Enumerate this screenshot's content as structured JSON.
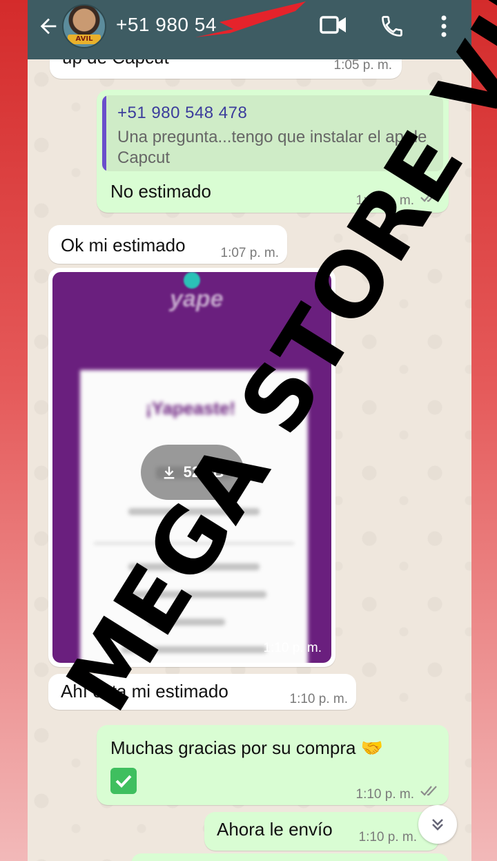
{
  "header": {
    "contact_name": "+51 980 54",
    "avatar_tag": "AVIL"
  },
  "messages": [
    {
      "text": "up de Capcut",
      "time": "1:05 p. m."
    },
    {
      "quote": {
        "name": "+51 980 548 478",
        "text": "Una pregunta...tengo que instalar el ap de Capcut"
      },
      "text": "No estimado",
      "time": "1:07 p. m."
    },
    {
      "text": "Ok mi estimado",
      "time": "1:07 p. m."
    },
    {
      "image_size": "52 kB",
      "image_title": "¡Yapeaste!",
      "time": "1:10 p. m."
    },
    {
      "text": "Ahí esta mi estimado",
      "time": "1:10 p. m."
    },
    {
      "text": "Muchas gracias por su compra 🤝",
      "time": "1:10 p. m."
    },
    {
      "text": "Ahora le envío",
      "time": "1:10 p. m."
    }
  ],
  "watermark": "MEGA STORE VIP",
  "colors": {
    "header": "#3e5c63",
    "outgoing_bubble": "#d9fdd3",
    "incoming_bubble": "#ffffff",
    "chat_bg": "#efe7dd",
    "read_ticks": "#8c8c8c"
  },
  "icons": [
    "back-arrow-icon",
    "video-call-icon",
    "phone-icon",
    "more-vert-icon",
    "download-icon",
    "double-check-icon",
    "chevron-double-down-icon",
    "check-box-icon"
  ]
}
